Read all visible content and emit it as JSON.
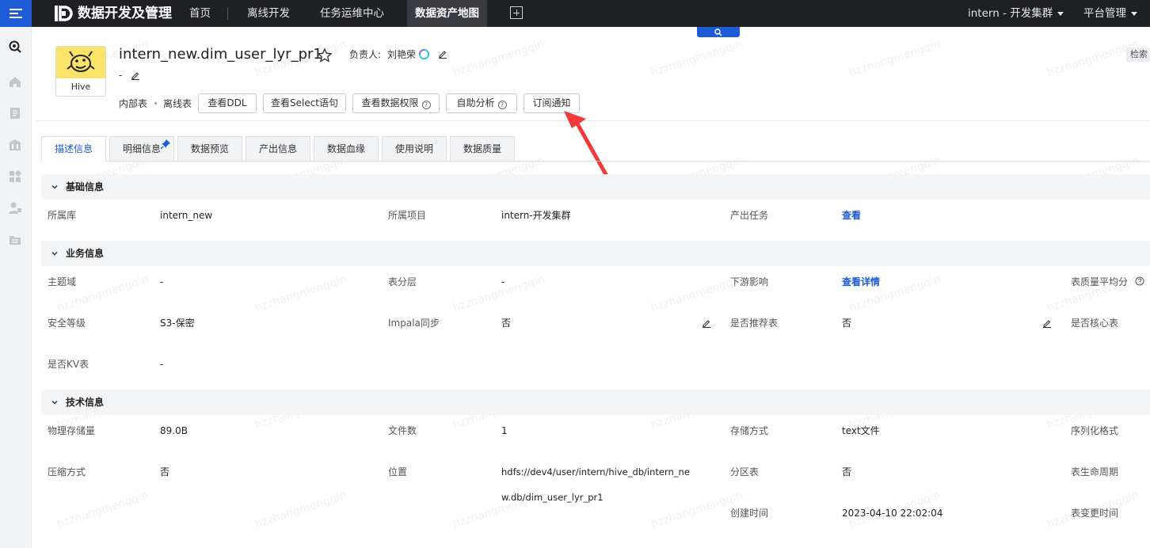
{
  "topbar": {
    "brand": "数据开发及管理",
    "nav": [
      "首页",
      "离线开发",
      "任务运维中心",
      "数据资产地图"
    ],
    "active_nav": "数据资产地图",
    "cluster": "intern - 开发集群",
    "platform": "平台管理"
  },
  "header": {
    "hive_label": "Hive",
    "table_name": "intern_new.dim_user_lyr_pr1",
    "owner_label": "负责人:",
    "owner_name": "刘艳荣",
    "description": "-",
    "tags": [
      "内部表",
      "离线表"
    ],
    "buttons": [
      "查看DDL",
      "查看Select语句",
      "查看数据权限",
      "自助分析",
      "订阅通知"
    ],
    "side_search": "检索"
  },
  "tabs": [
    "描述信息",
    "明细信息",
    "数据预览",
    "产出信息",
    "数据血缘",
    "使用说明",
    "数据质量"
  ],
  "sections": {
    "basic": {
      "title": "基础信息",
      "db_label": "所属库",
      "db_value": "intern_new",
      "project_label": "所属项目",
      "project_value": "intern-开发集群",
      "task_label": "产出任务",
      "task_link": "查看"
    },
    "business": {
      "title": "业务信息",
      "domain_label": "主题域",
      "domain_value": "-",
      "layer_label": "表分层",
      "layer_value": "-",
      "downstream_label": "下游影响",
      "downstream_link": "查看详情",
      "quality_label": "表质量平均分",
      "security_label": "安全等级",
      "security_value": "S3-保密",
      "impala_label": "Impala同步",
      "impala_value": "否",
      "recommend_label": "是否推荐表",
      "recommend_value": "否",
      "core_label": "是否核心表",
      "kv_label": "是否KV表",
      "kv_value": "-"
    },
    "tech": {
      "title": "技术信息",
      "storage_size_label": "物理存储量",
      "storage_size_value": "89.0B",
      "file_count_label": "文件数",
      "file_count_value": "1",
      "storage_mode_label": "存储方式",
      "storage_mode_value": "text文件",
      "serde_label": "序列化格式",
      "compress_label": "压缩方式",
      "compress_value": "否",
      "location_label": "位置",
      "location_line1": "hdfs://dev4/user/intern/hive_db/intern_ne",
      "location_line2": "w.db/dim_user_lyr_pr1",
      "partition_label": "分区表",
      "partition_value": "否",
      "lifecycle_label": "表生命周期",
      "create_time_label": "创建时间",
      "create_time_value": "2023-04-10 22:02:04",
      "change_time_label": "表变更时间"
    }
  },
  "watermark": "hzzhangmengqin",
  "colors": {
    "accent": "#1e5bd6",
    "topbar": "#1f2024",
    "arrow": "#f23a3a"
  }
}
